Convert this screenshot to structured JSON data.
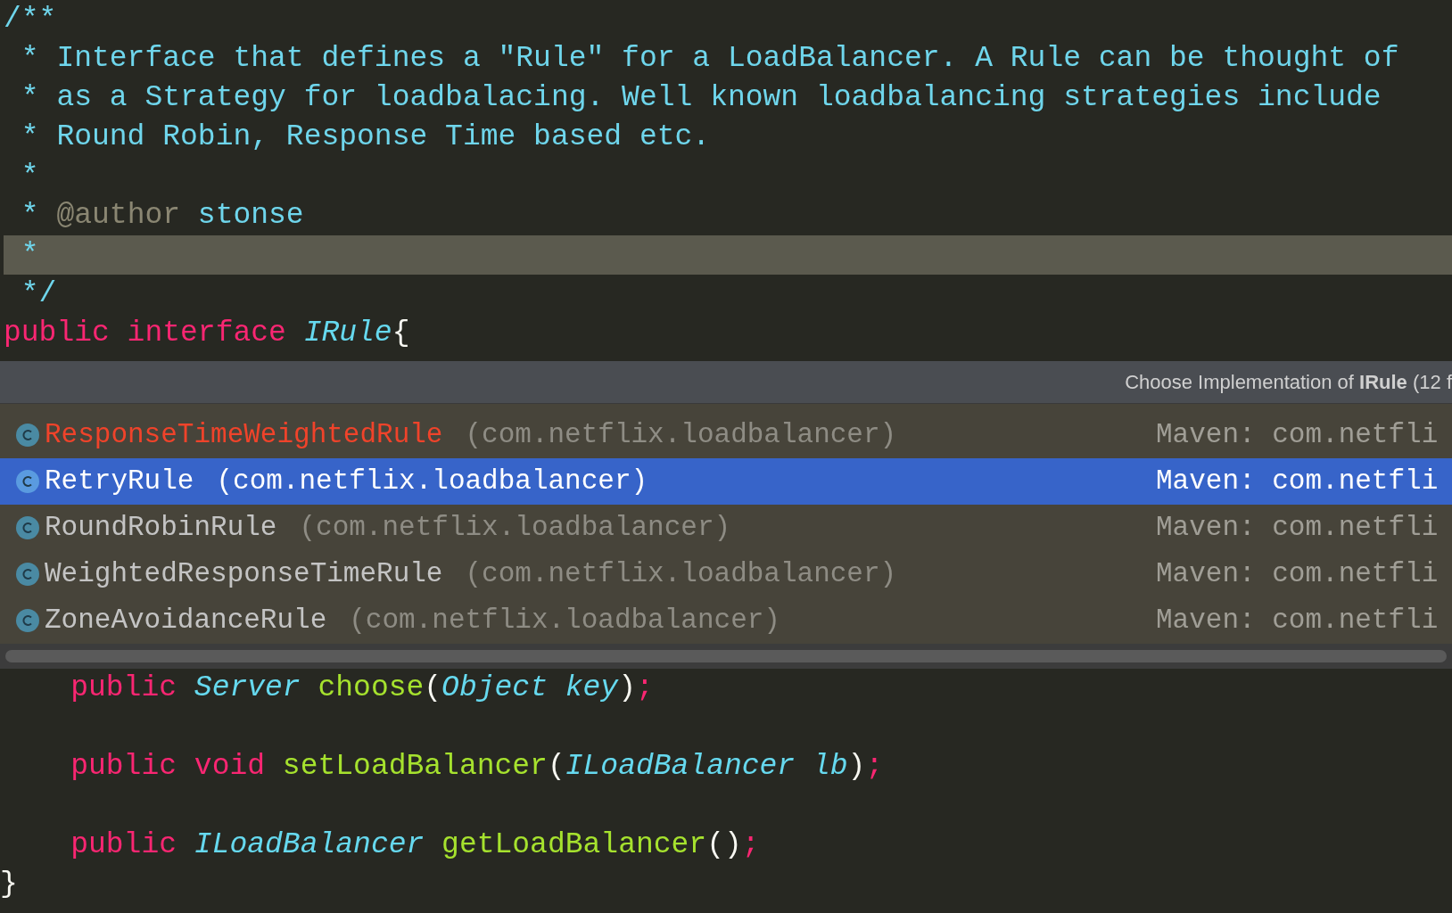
{
  "code_top": [
    {
      "current": false,
      "tokens": [
        {
          "kind": "comment",
          "text": "/**"
        }
      ]
    },
    {
      "current": false,
      "tokens": [
        {
          "kind": "doc",
          "text": " * Interface that defines a \"Rule\" for a LoadBalancer. A Rule can be thought of"
        }
      ]
    },
    {
      "current": false,
      "tokens": [
        {
          "kind": "doc",
          "text": " * as a Strategy for loadbalacing. Well known loadbalancing strategies include"
        }
      ]
    },
    {
      "current": false,
      "tokens": [
        {
          "kind": "doc",
          "text": " * Round Robin, Response Time based etc."
        }
      ]
    },
    {
      "current": false,
      "tokens": [
        {
          "kind": "doc",
          "text": " *"
        }
      ]
    },
    {
      "current": false,
      "tokens": [
        {
          "kind": "doc",
          "text": " * "
        },
        {
          "kind": "tag",
          "text": "@author"
        },
        {
          "kind": "doc",
          "text": " stonse"
        }
      ]
    },
    {
      "current": true,
      "tokens": [
        {
          "kind": "doc",
          "text": " *"
        }
      ]
    },
    {
      "current": false,
      "tokens": [
        {
          "kind": "doc",
          "text": " */"
        }
      ]
    },
    {
      "current": false,
      "tokens": [
        {
          "kind": "keyword",
          "text": "public interface "
        },
        {
          "kind": "type",
          "text": "IRule"
        },
        {
          "kind": "punct",
          "text": "{"
        }
      ]
    }
  ],
  "popup": {
    "title": "Choose Implementation of **IRule** (12 f",
    "items": [
      {
        "name": "ResponseTimeWeightedRule",
        "package": "(com.netflix.loadbalancer)",
        "source": "Maven: com.netfli",
        "kind": "error",
        "selected": false
      },
      {
        "name": "RetryRule",
        "package": "(com.netflix.loadbalancer)",
        "source": "Maven: com.netfli",
        "kind": "normal",
        "selected": true
      },
      {
        "name": "RoundRobinRule",
        "package": "(com.netflix.loadbalancer)",
        "source": "Maven: com.netfli",
        "kind": "normal",
        "selected": false
      },
      {
        "name": "WeightedResponseTimeRule",
        "package": "(com.netflix.loadbalancer)",
        "source": "Maven: com.netfli",
        "kind": "normal",
        "selected": false
      },
      {
        "name": "ZoneAvoidanceRule",
        "package": "(com.netflix.loadbalancer)",
        "source": "Maven: com.netfli",
        "kind": "normal",
        "selected": false
      }
    ]
  },
  "code_bottom": [
    {
      "kind": "code",
      "tokens": [
        {
          "kind": "keyword",
          "text": "    public "
        },
        {
          "kind": "type",
          "text": "Server"
        },
        {
          "kind": "method",
          "text": " choose"
        },
        {
          "kind": "punct",
          "text": "("
        },
        {
          "kind": "type",
          "text": "Object key"
        },
        {
          "kind": "punct",
          "text": ")"
        },
        {
          "kind": "keyword",
          "text": ";"
        }
      ]
    },
    {
      "kind": "blank"
    },
    {
      "kind": "code",
      "tokens": [
        {
          "kind": "keyword",
          "text": "    public void "
        },
        {
          "kind": "method",
          "text": "setLoadBalancer"
        },
        {
          "kind": "punct",
          "text": "("
        },
        {
          "kind": "type",
          "text": "ILoadBalancer lb"
        },
        {
          "kind": "punct",
          "text": ")"
        },
        {
          "kind": "keyword",
          "text": ";"
        }
      ]
    },
    {
      "kind": "blank"
    },
    {
      "kind": "code",
      "tokens": [
        {
          "kind": "keyword",
          "text": "    public "
        },
        {
          "kind": "type",
          "text": "ILoadBalancer"
        },
        {
          "kind": "method",
          "text": " getLoadBalancer"
        },
        {
          "kind": "punct",
          "text": "()"
        },
        {
          "kind": "keyword",
          "text": ";"
        }
      ]
    },
    {
      "kind": "code",
      "tokens": [
        {
          "kind": "punct",
          "text": "}"
        }
      ]
    }
  ]
}
